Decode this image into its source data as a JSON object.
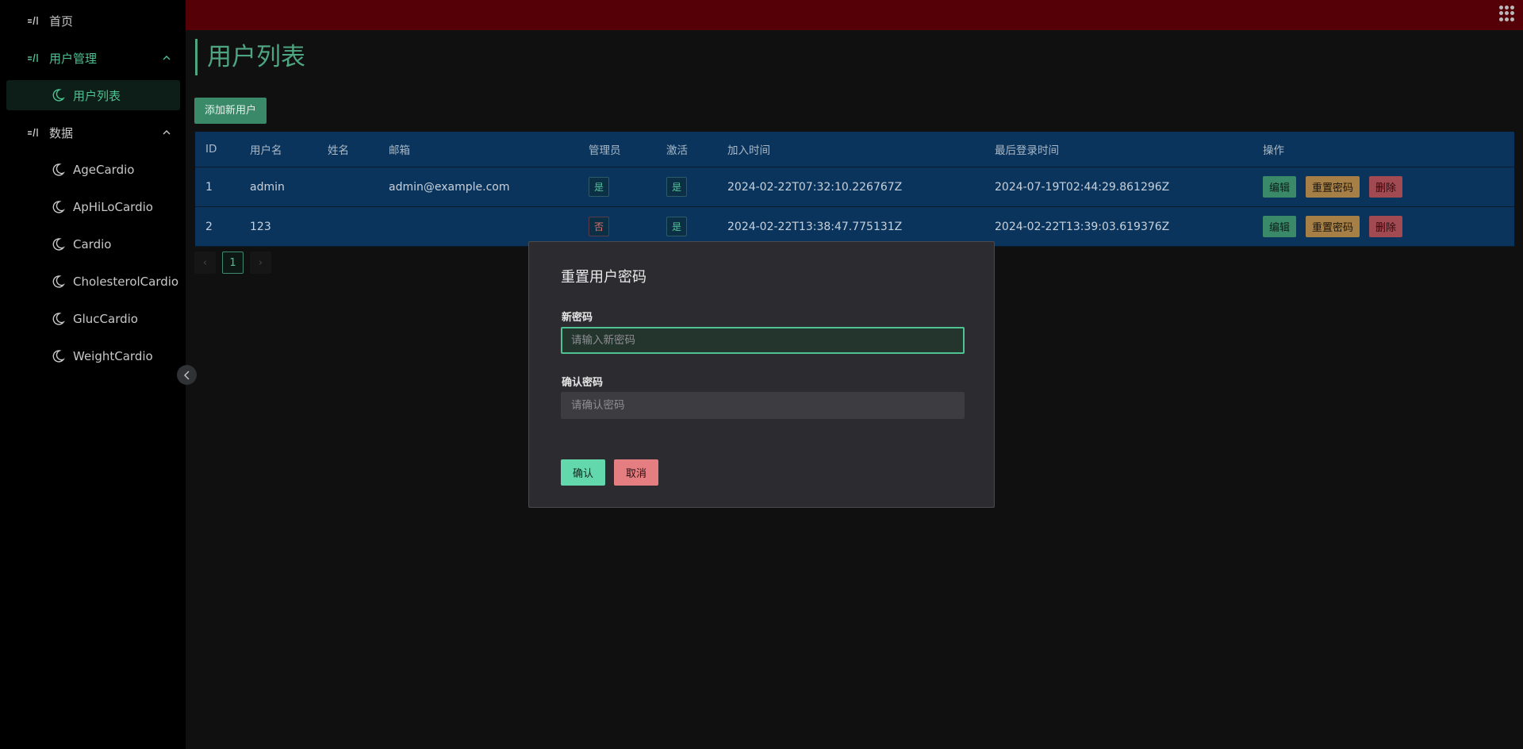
{
  "sidebar": {
    "home": "首页",
    "user_mgmt": "用户管理",
    "user_list": "用户列表",
    "data": "数据",
    "data_items": [
      "AgeCardio",
      "ApHiLoCardio",
      "Cardio",
      "CholesterolCardio",
      "GlucCardio",
      "WeightCardio"
    ]
  },
  "page": {
    "title": "用户列表",
    "add_button": "添加新用户"
  },
  "table": {
    "headers": [
      "ID",
      "用户名",
      "姓名",
      "邮箱",
      "管理员",
      "激活",
      "加入时间",
      "最后登录时间",
      "操作"
    ],
    "rows": [
      {
        "id": "1",
        "username": "admin",
        "name": "",
        "email": "admin@example.com",
        "admin": "是",
        "active": "是",
        "joined": "2024-02-22T07:32:10.226767Z",
        "last_login": "2024-07-19T02:44:29.861296Z"
      },
      {
        "id": "2",
        "username": "123",
        "name": "",
        "email": "",
        "admin": "否",
        "active": "是",
        "joined": "2024-02-22T13:38:47.775131Z",
        "last_login": "2024-02-22T13:39:03.619376Z"
      }
    ],
    "ops": {
      "edit": "编辑",
      "reset": "重置密码",
      "delete": "删除"
    }
  },
  "pagination": {
    "current": "1",
    "prev": "‹",
    "next": "›"
  },
  "modal": {
    "title": "重置用户密码",
    "new_label": "新密码",
    "new_placeholder": "请输入新密码",
    "confirm_label": "确认密码",
    "confirm_placeholder": "请确认密码",
    "ok": "确认",
    "cancel": "取消"
  },
  "colors": {
    "accent": "#4ec292",
    "topbar": "#550006",
    "table": "#0b345c"
  }
}
